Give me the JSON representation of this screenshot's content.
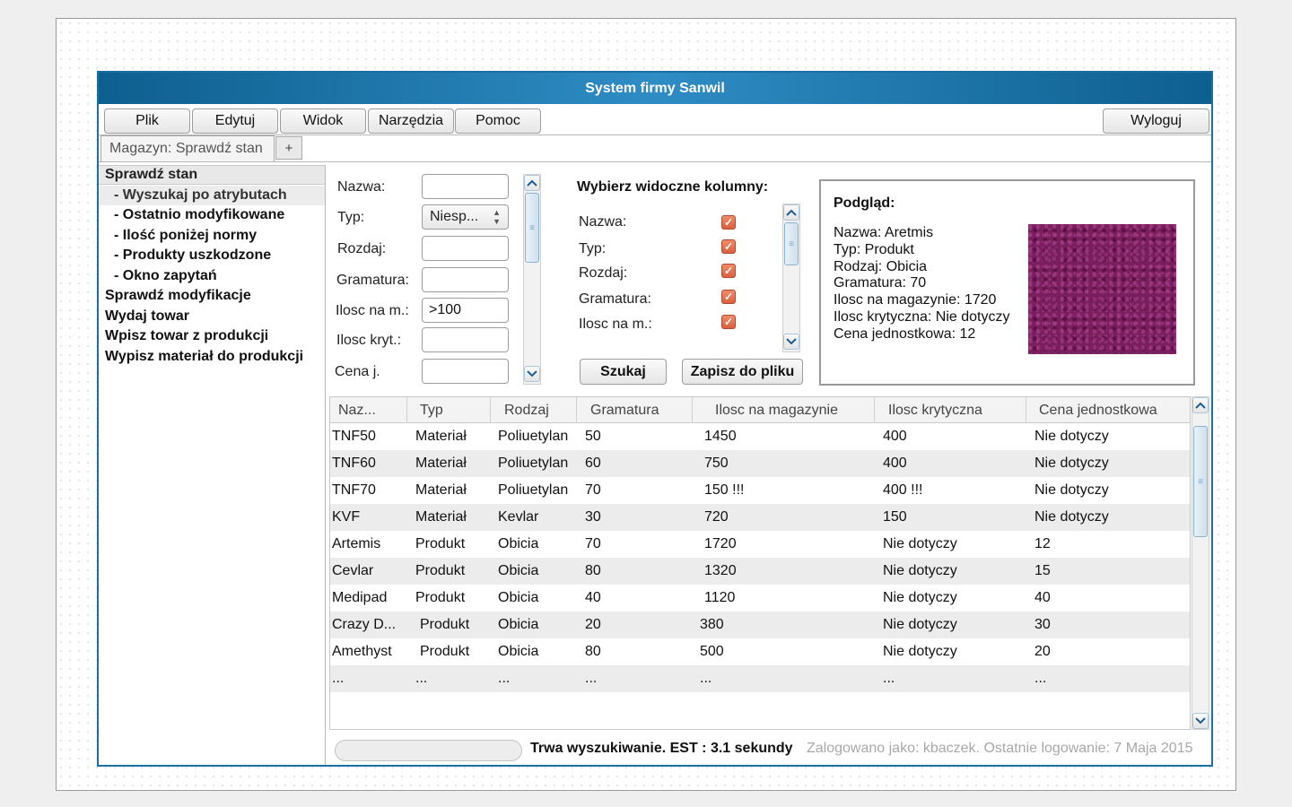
{
  "window": {
    "title": "System firmy Sanwil"
  },
  "menu": {
    "items": [
      "Plik",
      "Edytuj",
      "Widok",
      "Narzędzia",
      "Pomoc"
    ],
    "logout": "Wyloguj"
  },
  "tabs": {
    "active": "Magazyn: Sprawdź stan",
    "add": "+"
  },
  "sidebar": {
    "items": [
      {
        "label": "Sprawdź stan",
        "level": 0,
        "state": "header"
      },
      {
        "label": "- Wyszukaj po atrybutach",
        "level": 1,
        "state": "selected"
      },
      {
        "label": "- Ostatnio modyfikowane",
        "level": 1,
        "state": ""
      },
      {
        "label": "- Ilość poniżej normy",
        "level": 1,
        "state": ""
      },
      {
        "label": "- Produkty uszkodzone",
        "level": 1,
        "state": ""
      },
      {
        "label": "- Okno zapytań",
        "level": 1,
        "state": ""
      },
      {
        "label": "Sprawdź modyfikacje",
        "level": 0,
        "state": ""
      },
      {
        "label": "Wydaj towar",
        "level": 0,
        "state": ""
      },
      {
        "label": "Wpisz towar z produkcji",
        "level": 0,
        "state": ""
      },
      {
        "label": "Wypisz materiał do produkcji",
        "level": 0,
        "state": ""
      }
    ]
  },
  "filters": {
    "fields": [
      {
        "label": "Nazwa:",
        "value": "",
        "type": "text"
      },
      {
        "label": "Typ:",
        "value": "Niesp...",
        "type": "select"
      },
      {
        "label": "Rozdaj:",
        "value": "",
        "type": "text"
      },
      {
        "label": "Gramatura:",
        "value": "",
        "type": "text"
      },
      {
        "label": "Ilosc na m.:",
        "value": ">100",
        "type": "text"
      },
      {
        "label": "Ilosc kryt.:",
        "value": "",
        "type": "text"
      },
      {
        "label": "Cena j.",
        "value": "",
        "type": "text"
      }
    ]
  },
  "columns_picker": {
    "title": "Wybierz widoczne kolumny:",
    "items": [
      {
        "label": "Nazwa:",
        "checked": true
      },
      {
        "label": "Typ:",
        "checked": true
      },
      {
        "label": "Rozdaj:",
        "checked": true
      },
      {
        "label": "Gramatura:",
        "checked": true
      },
      {
        "label": "Ilosc na m.:",
        "checked": true
      }
    ],
    "search_button": "Szukaj",
    "save_button": "Zapisz do pliku"
  },
  "preview": {
    "title": "Podgląd:",
    "lines": [
      "Nazwa: Aretmis",
      "Typ: Produkt",
      "Rodzaj: Obicia",
      "Gramatura: 70",
      "Ilosc na magazynie: 1720",
      "Ilosc krytyczna: Nie dotyczy",
      "Cena jednostkowa: 12"
    ],
    "image": "fabric-texture-purple"
  },
  "table": {
    "columns": [
      "Naz...",
      "Typ",
      "Rodzaj",
      "Gramatura",
      "Ilosc na magazynie",
      "Ilosc krytyczna",
      "Cena jednostkowa"
    ],
    "rows": [
      [
        "TNF50",
        "Materiał",
        "Poliuetylan",
        "50",
        "1450",
        "400",
        "Nie dotyczy"
      ],
      [
        "TNF60",
        "Materiał",
        "Poliuetylan",
        "60",
        "750",
        "400",
        "Nie dotyczy"
      ],
      [
        "TNF70",
        "Materiał",
        "Poliuetylan",
        "70",
        "150 !!!",
        "400 !!!",
        "Nie dotyczy"
      ],
      [
        "KVF",
        "Materiał",
        "Kevlar",
        "30",
        "720",
        "150",
        "Nie dotyczy"
      ],
      [
        "Artemis",
        "Produkt",
        "Obicia",
        "70",
        "1720",
        "Nie dotyczy",
        "12"
      ],
      [
        "Cevlar",
        "Produkt",
        "Obicia",
        "80",
        "1320",
        "Nie dotyczy",
        "15"
      ],
      [
        "Medipad",
        "Produkt",
        "Obicia",
        "40",
        "1120",
        "Nie dotyczy",
        "40"
      ],
      [
        "Crazy D...",
        "Produkt",
        "Obicia",
        "20",
        "380",
        "Nie dotyczy",
        "30"
      ],
      [
        "Amethyst",
        "Produkt",
        "Obicia",
        "80",
        "500",
        "Nie dotyczy",
        "20"
      ],
      [
        "...",
        "...",
        "...",
        "...",
        "...",
        "...",
        "..."
      ]
    ]
  },
  "status": {
    "progress": 0,
    "message": "Trwa wyszukiwanie. EST : 3.1 sekundy",
    "user_info": "Zalogowano jako: kbaczek. Ostatnie logowanie: 7 Maja 2015"
  },
  "colors": {
    "titlebar": "#1b6fa3",
    "checkbox": "#e07050",
    "scroll_accent": "#88b2d2"
  }
}
